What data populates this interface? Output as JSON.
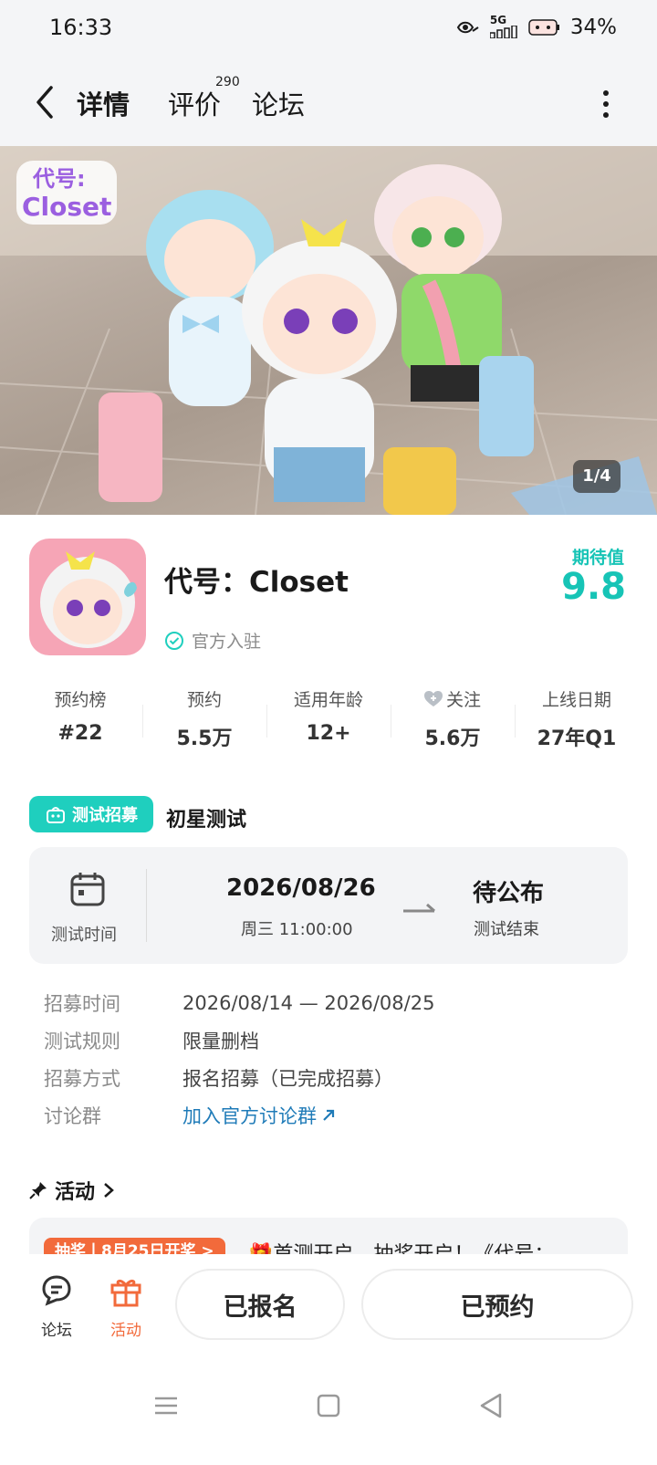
{
  "status_bar": {
    "time": "16:33",
    "network": "5G",
    "battery": "34%"
  },
  "nav": {
    "tabs": [
      {
        "label": "详情"
      },
      {
        "label": "评价",
        "badge": "290"
      },
      {
        "label": "论坛"
      }
    ]
  },
  "hero": {
    "page_indicator": "1/4",
    "logo_text_1": "代号:",
    "logo_text_2": "Closet"
  },
  "game": {
    "title": "代号：Closet",
    "official_label": "官方入驻",
    "expect_label": "期待值",
    "expect_value": "9.8"
  },
  "stats": [
    {
      "label": "预约榜",
      "value": "#22"
    },
    {
      "label": "预约",
      "value": "5.5万"
    },
    {
      "label": "适用年龄",
      "value": "12+"
    },
    {
      "label": "关注",
      "value": "5.6万"
    },
    {
      "label": "上线日期",
      "value": "27年Q1"
    }
  ],
  "recruit": {
    "badge": "测试招募",
    "title": "初星测试",
    "time_label": "测试时间",
    "start_date": "2026/08/26",
    "start_time": "周三  11:00:00",
    "end_value": "待公布",
    "end_label": "测试结束"
  },
  "details": [
    {
      "key": "招募时间",
      "value": "2026/08/14 — 2026/08/25"
    },
    {
      "key": "测试规则",
      "value": "限量删档"
    },
    {
      "key": "招募方式",
      "value": "报名招募（已完成招募）"
    },
    {
      "key": "讨论群",
      "value": "加入官方讨论群"
    }
  ],
  "activity": {
    "heading": "活动",
    "tag": "抽奖丨8月25日开奖 >",
    "text": "🎁首测开启，抽奖开启！《代号："
  },
  "bottom": {
    "forum": "论坛",
    "activity": "活动",
    "signed_button": "已报名",
    "reserved_button": "已预约"
  },
  "colors": {
    "accent": "#1fcfbe",
    "orange": "#f26a3b",
    "link": "#1f7bb8"
  }
}
